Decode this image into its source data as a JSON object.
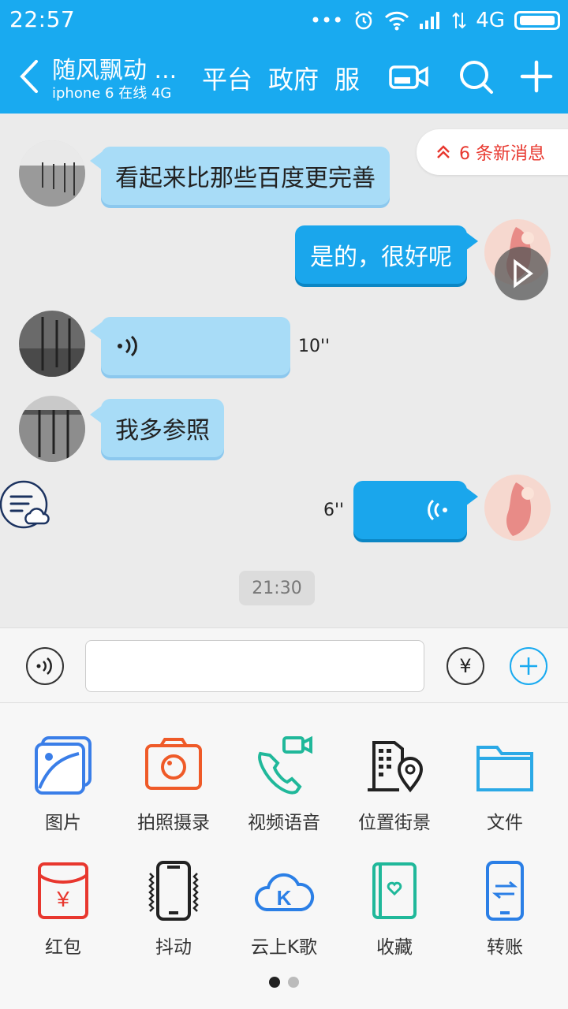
{
  "status_bar": {
    "time": "22:57",
    "network": "4G",
    "icons": [
      "more-dots-icon",
      "alarm-icon",
      "wifi-icon",
      "signal-icon",
      "data-arrows-icon",
      "battery-icon"
    ]
  },
  "title_bar": {
    "contact_name": "随风飘动 ...",
    "contact_status": "iphone 6 在线  4G",
    "tabs": [
      "平台",
      "政府",
      "服"
    ],
    "icons": [
      "back-icon",
      "video-call-icon",
      "search-icon",
      "plus-icon"
    ]
  },
  "new_messages": {
    "label": "6 条新消息"
  },
  "messages": [
    {
      "dir": "in",
      "type": "text",
      "text": "看起来比那些百度更完善"
    },
    {
      "dir": "out",
      "type": "text",
      "text": "是的，很好呢"
    },
    {
      "dir": "in",
      "type": "voice",
      "duration": "10''"
    },
    {
      "dir": "in",
      "type": "text",
      "text": "我多参照"
    },
    {
      "dir": "out",
      "type": "voice",
      "duration": "6''"
    }
  ],
  "timestamp": "21:30",
  "input": {
    "value": "",
    "placeholder": ""
  },
  "panel": {
    "row1": [
      {
        "label": "图片",
        "icon": "picture-icon"
      },
      {
        "label": "拍照摄录",
        "icon": "camera-icon"
      },
      {
        "label": "视频语音",
        "icon": "video-phone-icon"
      },
      {
        "label": "位置街景",
        "icon": "location-icon"
      },
      {
        "label": "文件",
        "icon": "folder-icon"
      }
    ],
    "row2": [
      {
        "label": "红包",
        "icon": "red-packet-icon"
      },
      {
        "label": "抖动",
        "icon": "shake-icon"
      },
      {
        "label": "云上K歌",
        "icon": "cloud-karaoke-icon"
      },
      {
        "label": "收藏",
        "icon": "favorites-icon"
      },
      {
        "label": "转账",
        "icon": "transfer-icon"
      }
    ],
    "page_count": 2,
    "current_page": 1
  },
  "colors": {
    "brand": "#19aaf0",
    "bubble_in": "#a8dcf7",
    "bubble_out": "#1aa6ec",
    "alert": "#e8372e"
  }
}
